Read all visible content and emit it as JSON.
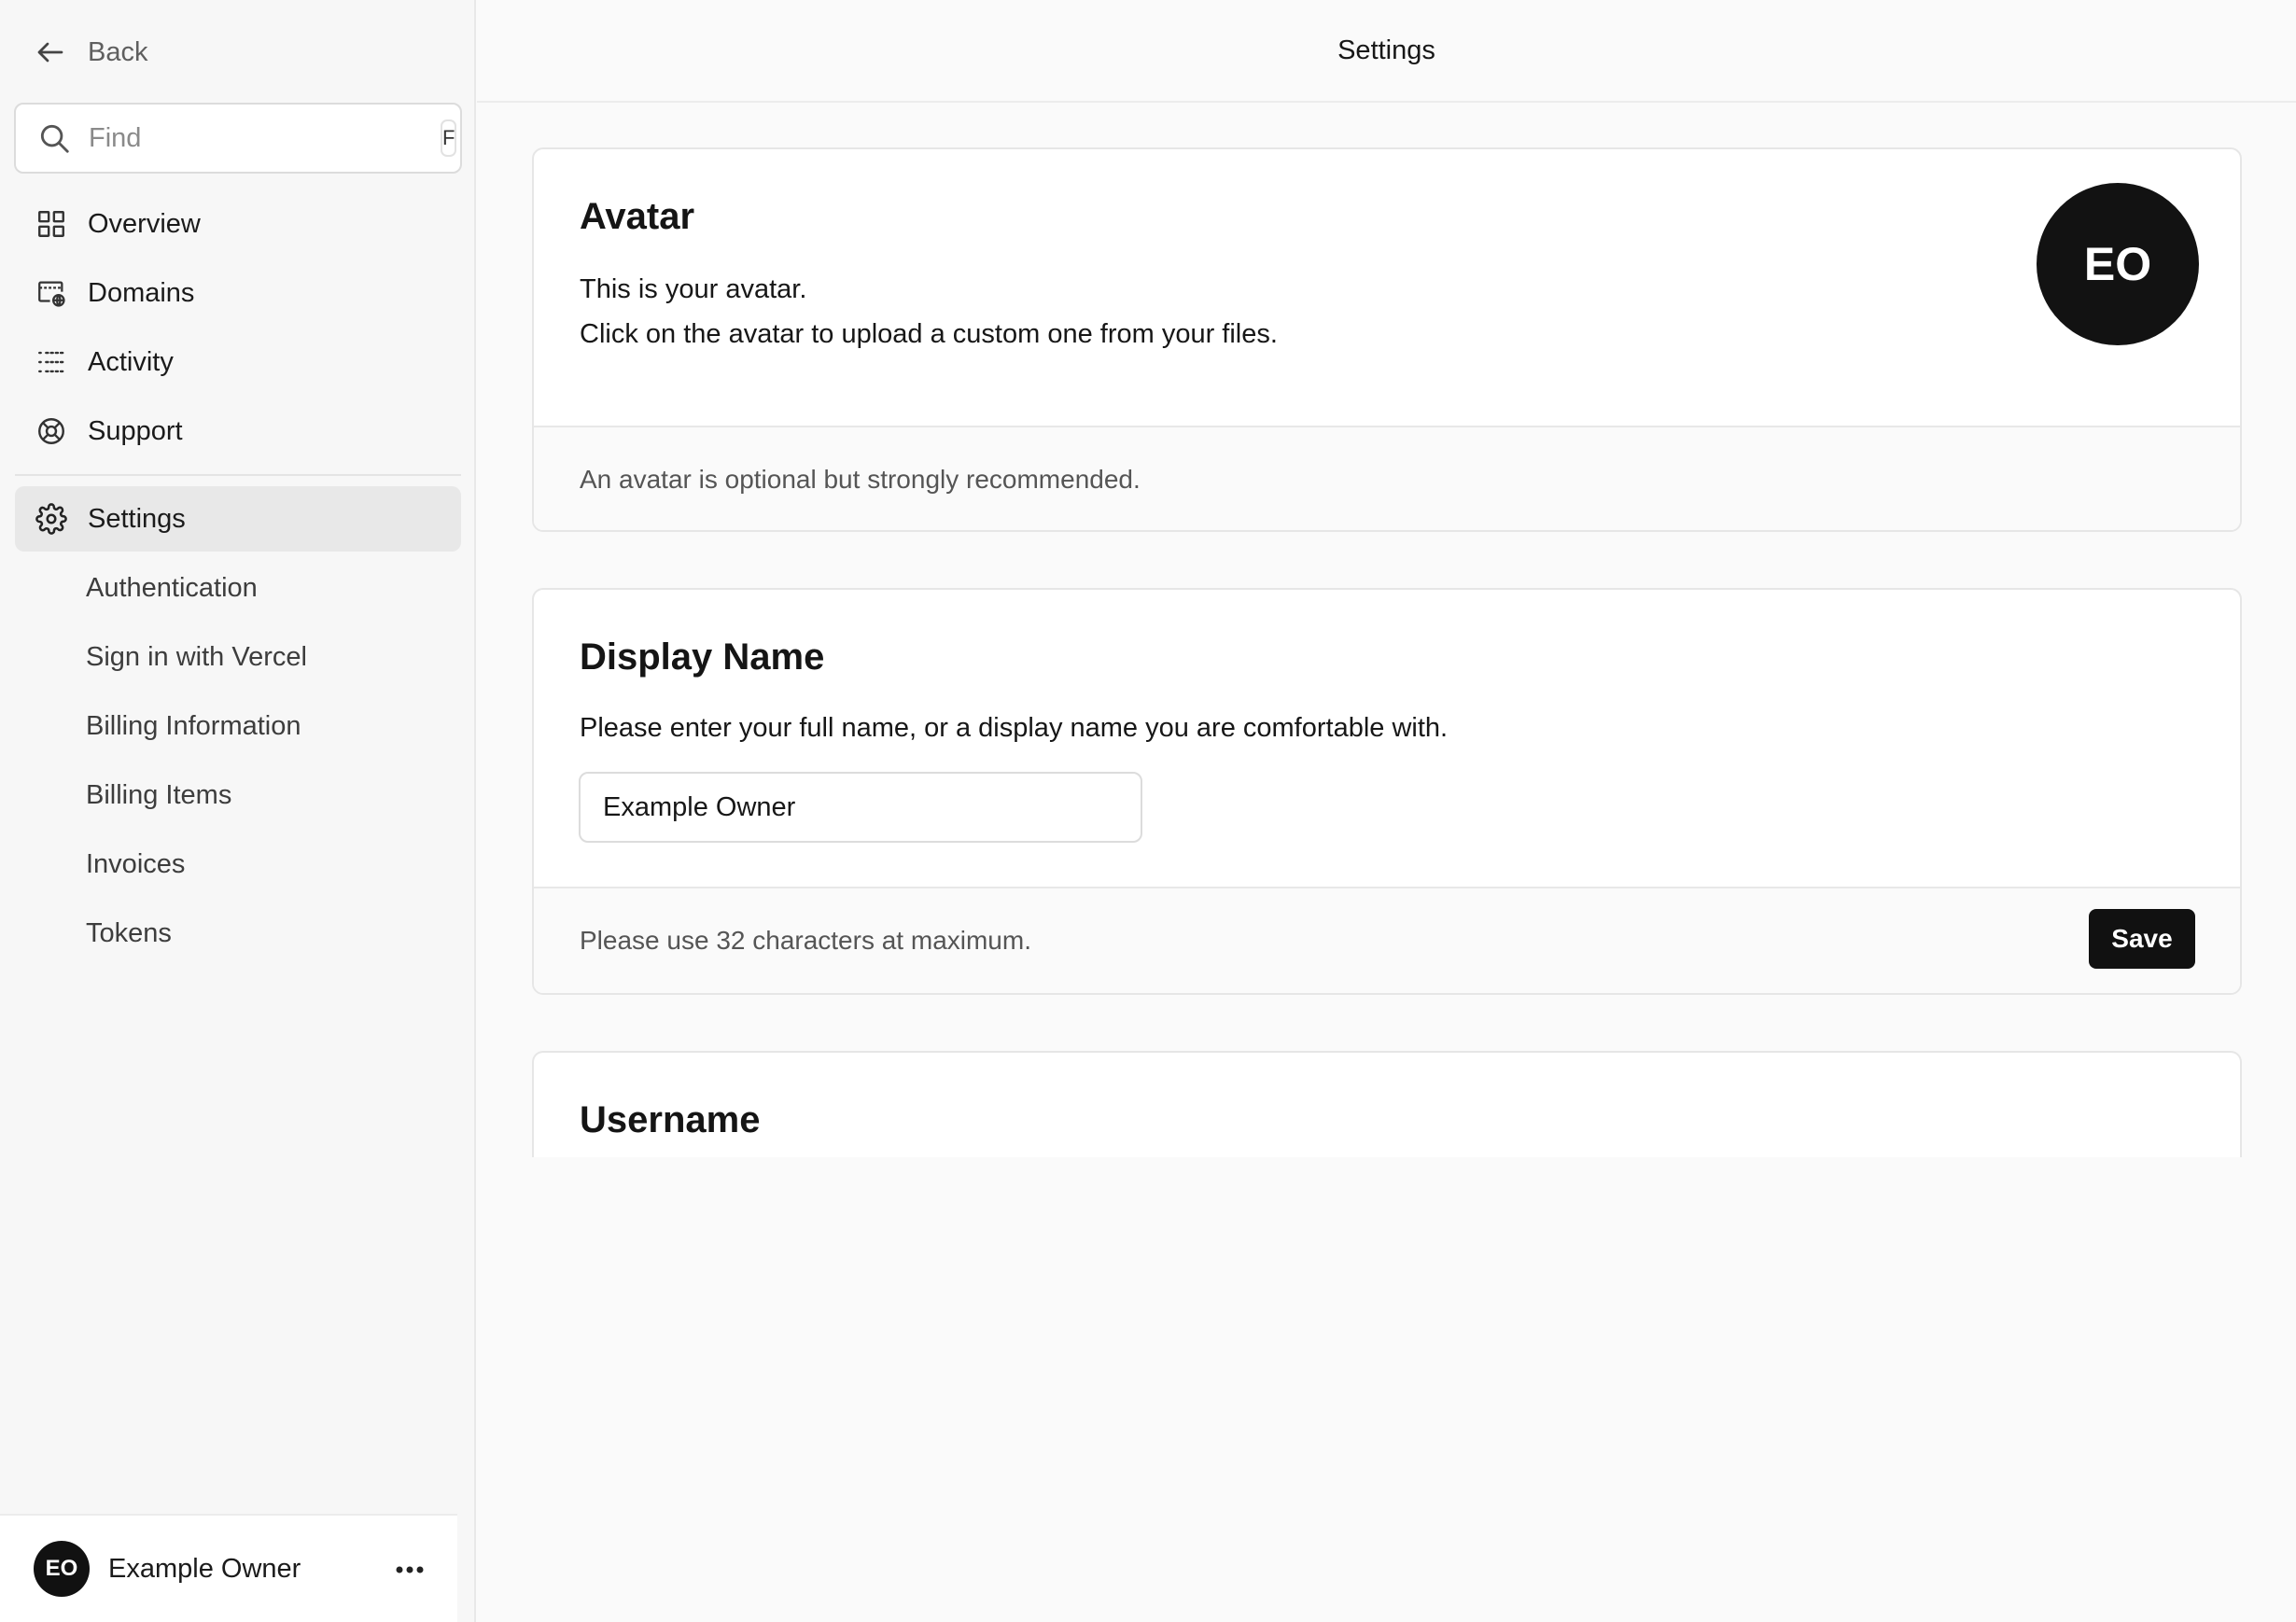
{
  "sidebar": {
    "back_label": "Back",
    "search": {
      "placeholder": "Find",
      "shortcut": "F"
    },
    "nav": [
      {
        "label": "Overview",
        "icon": "grid-icon"
      },
      {
        "label": "Domains",
        "icon": "globe-screen-icon"
      },
      {
        "label": "Activity",
        "icon": "list-icon"
      },
      {
        "label": "Support",
        "icon": "lifebuoy-icon"
      }
    ],
    "settings": {
      "label": "Settings",
      "icon": "gear-icon"
    },
    "sub_items": [
      "Authentication",
      "Sign in with Vercel",
      "Billing Information",
      "Billing Items",
      "Invoices",
      "Tokens"
    ],
    "user": {
      "initials": "EO",
      "name": "Example Owner"
    }
  },
  "header": {
    "title": "Settings"
  },
  "avatar_card": {
    "title": "Avatar",
    "desc_line1": "This is your avatar.",
    "desc_line2": "Click on the avatar to upload a custom one from your files.",
    "footer": "An avatar is optional but strongly recommended.",
    "initials": "EO"
  },
  "display_name_card": {
    "title": "Display Name",
    "desc": "Please enter your full name, or a display name you are comfortable with.",
    "value": "Example Owner",
    "footer": "Please use 32 characters at maximum.",
    "save_label": "Save"
  },
  "username_card": {
    "title": "Username"
  },
  "colors": {
    "accent": "#111111",
    "background": "#fafafa",
    "sidebar": "#f7f7f7"
  }
}
